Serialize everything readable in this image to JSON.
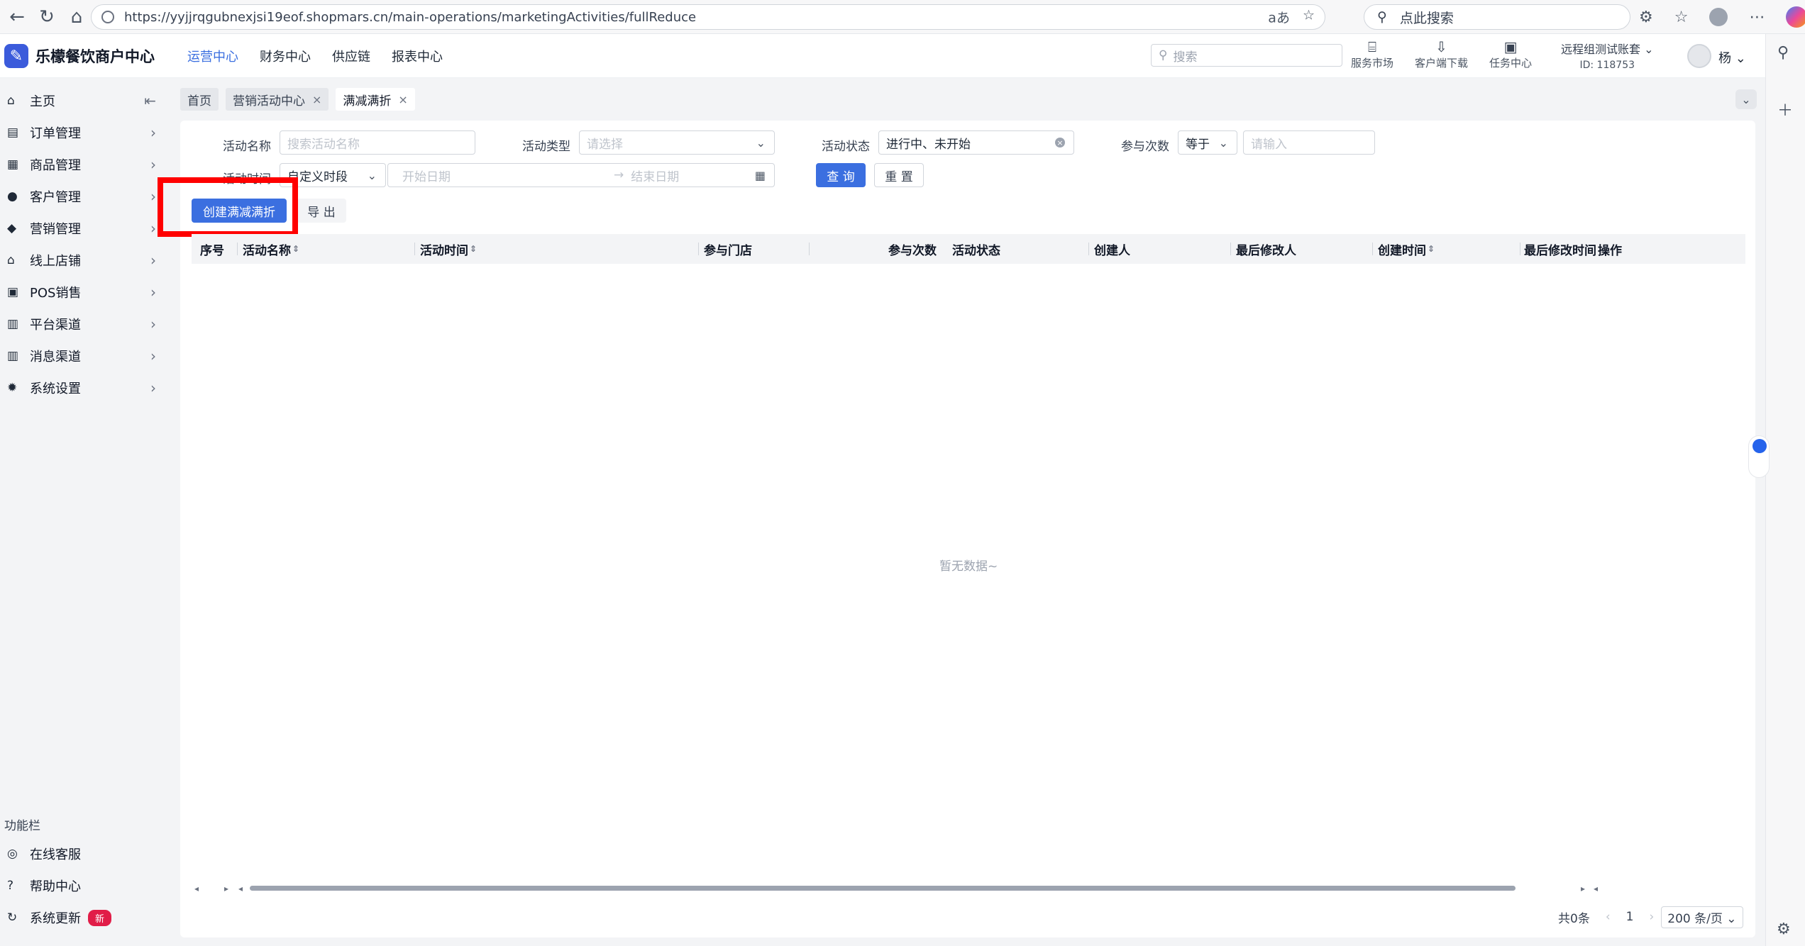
{
  "browser": {
    "url": "https://yyjjrqgubnexjsi19eof.shopmars.cn/main-operations/marketingActivities/fullReduce",
    "search_placeholder": "点此搜索"
  },
  "header": {
    "logo_text": "乐檬餐饮商户中心",
    "nav": [
      "运营中心",
      "财务中心",
      "供应链",
      "报表中心"
    ],
    "search_placeholder": "搜索",
    "icons": [
      {
        "label": "服务市场",
        "icon": "shop-icon"
      },
      {
        "label": "客户端下载",
        "icon": "download-icon"
      },
      {
        "label": "任务中心",
        "icon": "task-icon"
      }
    ],
    "account_name": "远程组测试账套",
    "account_id": "ID: 118753",
    "user_name": "杨"
  },
  "sidebar": {
    "items": [
      {
        "label": "主页",
        "icon": "home-icon"
      },
      {
        "label": "订单管理",
        "icon": "order-icon"
      },
      {
        "label": "商品管理",
        "icon": "goods-icon"
      },
      {
        "label": "客户管理",
        "icon": "user-icon"
      },
      {
        "label": "营销管理",
        "icon": "tag-icon"
      },
      {
        "label": "线上店铺",
        "icon": "store-icon"
      },
      {
        "label": "POS销售",
        "icon": "pos-icon"
      },
      {
        "label": "平台渠道",
        "icon": "platform-icon"
      },
      {
        "label": "消息渠道",
        "icon": "message-icon"
      },
      {
        "label": "系统设置",
        "icon": "gear-icon"
      }
    ],
    "func_title": "功能栏",
    "func_items": [
      {
        "label": "在线客服",
        "icon": "service-icon"
      },
      {
        "label": "帮助中心",
        "icon": "help-icon"
      },
      {
        "label": "系统更新",
        "icon": "refresh-icon",
        "badge": "新"
      }
    ]
  },
  "tabs": [
    {
      "label": "首页",
      "closable": false
    },
    {
      "label": "营销活动中心",
      "closable": true
    },
    {
      "label": "满减满折",
      "closable": true
    }
  ],
  "filters": {
    "name_label": "活动名称",
    "name_placeholder": "搜索活动名称",
    "type_label": "活动类型",
    "type_placeholder": "请选择",
    "status_label": "活动状态",
    "status_value": "进行中、未开始",
    "count_label": "参与次数",
    "count_op": "等于",
    "count_placeholder": "请输入",
    "time_label": "活动时间",
    "time_mode": "自定义时段",
    "start_placeholder": "开始日期",
    "end_placeholder": "结束日期",
    "query_label": "查 询",
    "reset_label": "重 置"
  },
  "actions": {
    "create_label": "创建满减满折",
    "export_label": "导 出"
  },
  "table": {
    "columns": [
      "序号",
      "活动名称",
      "活动时间",
      "参与门店",
      "参与次数",
      "活动状态",
      "创建人",
      "最后修改人",
      "创建时间",
      "最后修改时间",
      "操作"
    ],
    "empty_text": "暂无数据~"
  },
  "pager": {
    "total": "共0条",
    "page": "1",
    "page_size": "200 条/页"
  },
  "colors": {
    "primary": "#3b6fe0",
    "highlight": "#ff0000"
  }
}
